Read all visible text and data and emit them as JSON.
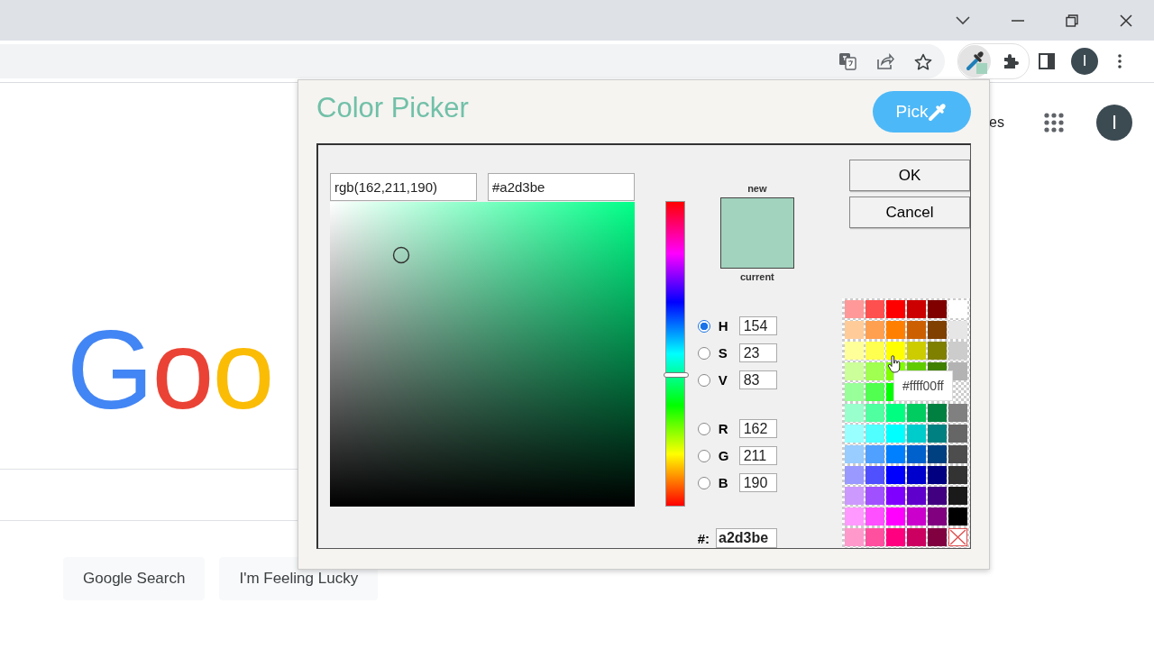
{
  "toolbar": {
    "avatar": "I"
  },
  "page": {
    "header_link": "es",
    "avatar": "I",
    "logo": [
      {
        "letter": "G",
        "color": "#4285f4"
      },
      {
        "letter": "o",
        "color": "#ea4335"
      },
      {
        "letter": "o",
        "color": "#fbbc05"
      }
    ],
    "buttons": [
      "Google Search",
      "I'm Feeling Lucky"
    ]
  },
  "picker": {
    "title": "Color Picker",
    "pick_button": "Pick",
    "rgb_value": "rgb(162,211,190)",
    "hex_value": "#a2d3be",
    "hue_slider": {
      "level": 0.43
    },
    "preview": {
      "top_label": "new",
      "bottom_label": "current"
    },
    "buttons": [
      "OK",
      "Cancel"
    ],
    "channels": [
      {
        "label": "H",
        "value": "154",
        "selected": true
      },
      {
        "label": "S",
        "value": "23",
        "selected": false
      },
      {
        "label": "V",
        "value": "83",
        "selected": false
      },
      {
        "label": "R",
        "value": "162",
        "selected": false
      },
      {
        "label": "G",
        "value": "211",
        "selected": false
      },
      {
        "label": "B",
        "value": "190",
        "selected": false
      }
    ],
    "hash_label": "#:",
    "hash_value": "a2d3be",
    "palette": [
      {
        "cells": [
          {
            "kind": "swatch",
            "color": "#ff9999"
          },
          {
            "kind": "swatch",
            "color": "#ff5050"
          },
          {
            "kind": "swatch",
            "color": "#ff0000"
          },
          {
            "kind": "swatch",
            "color": "#cc0000"
          },
          {
            "kind": "swatch",
            "color": "#800000"
          },
          {
            "kind": "swatch",
            "color": "#ffffff"
          }
        ]
      },
      {
        "cells": [
          {
            "kind": "swatch",
            "color": "#ffcc99"
          },
          {
            "kind": "swatch",
            "color": "#ffa050"
          },
          {
            "kind": "swatch",
            "color": "#ff8000"
          },
          {
            "kind": "swatch",
            "color": "#cc6000"
          },
          {
            "kind": "swatch",
            "color": "#804000"
          },
          {
            "kind": "swatch",
            "color": "#e6e6e6"
          }
        ]
      },
      {
        "cells": [
          {
            "kind": "swatch",
            "color": "#ffff99"
          },
          {
            "kind": "swatch",
            "color": "#ffff50"
          },
          {
            "kind": "swatch",
            "color": "#ffff00"
          },
          {
            "kind": "swatch",
            "color": "#cccc00"
          },
          {
            "kind": "swatch",
            "color": "#808000"
          },
          {
            "kind": "swatch",
            "color": "#cccccc"
          }
        ]
      },
      {
        "cells": [
          {
            "kind": "swatch",
            "color": "#ccff99"
          },
          {
            "kind": "swatch",
            "color": "#a0ff50"
          },
          {
            "kind": "swatch",
            "color": "#80ff00"
          },
          {
            "kind": "swatch",
            "color": "#60cc00"
          },
          {
            "kind": "swatch",
            "color": "#408000"
          },
          {
            "kind": "swatch",
            "color": "#b3b3b3"
          }
        ]
      },
      {
        "cells": [
          {
            "kind": "swatch",
            "color": "#99ff99"
          },
          {
            "kind": "swatch",
            "color": "#50ff50"
          },
          {
            "kind": "swatch",
            "color": "#00ff00"
          }
        ]
      },
      {
        "cells": [
          {
            "kind": "swatch",
            "color": "#99ffcc"
          },
          {
            "kind": "swatch",
            "color": "#50ffa0"
          },
          {
            "kind": "swatch",
            "color": "#00ff80"
          },
          {
            "kind": "swatch",
            "color": "#00cc60"
          },
          {
            "kind": "swatch",
            "color": "#008040"
          },
          {
            "kind": "swatch",
            "color": "#808080"
          }
        ]
      },
      {
        "cells": [
          {
            "kind": "swatch",
            "color": "#99ffff"
          },
          {
            "kind": "swatch",
            "color": "#50ffff"
          },
          {
            "kind": "swatch",
            "color": "#00ffff"
          },
          {
            "kind": "swatch",
            "color": "#00cccc"
          },
          {
            "kind": "swatch",
            "color": "#008080"
          },
          {
            "kind": "swatch",
            "color": "#666666"
          }
        ]
      },
      {
        "cells": [
          {
            "kind": "swatch",
            "color": "#99ccff"
          },
          {
            "kind": "swatch",
            "color": "#50a0ff"
          },
          {
            "kind": "swatch",
            "color": "#0080ff"
          },
          {
            "kind": "swatch",
            "color": "#0060cc"
          },
          {
            "kind": "swatch",
            "color": "#004080"
          },
          {
            "kind": "swatch",
            "color": "#4d4d4d"
          }
        ]
      },
      {
        "cells": [
          {
            "kind": "swatch",
            "color": "#9999ff"
          },
          {
            "kind": "swatch",
            "color": "#5050ff"
          },
          {
            "kind": "swatch",
            "color": "#0000ff"
          },
          {
            "kind": "swatch",
            "color": "#0000cc"
          },
          {
            "kind": "swatch",
            "color": "#000080"
          },
          {
            "kind": "swatch",
            "color": "#333333"
          }
        ]
      },
      {
        "cells": [
          {
            "kind": "swatch",
            "color": "#cc99ff"
          },
          {
            "kind": "swatch",
            "color": "#a050ff"
          },
          {
            "kind": "swatch",
            "color": "#8000ff"
          },
          {
            "kind": "swatch",
            "color": "#6000cc"
          },
          {
            "kind": "swatch",
            "color": "#400080"
          },
          {
            "kind": "swatch",
            "color": "#1a1a1a"
          }
        ]
      },
      {
        "cells": [
          {
            "kind": "swatch",
            "color": "#ff99ff"
          },
          {
            "kind": "swatch",
            "color": "#ff50ff"
          },
          {
            "kind": "swatch",
            "color": "#ff00ff"
          },
          {
            "kind": "swatch",
            "color": "#cc00cc"
          },
          {
            "kind": "swatch",
            "color": "#800080"
          },
          {
            "kind": "swatch",
            "color": "#000000"
          }
        ]
      },
      {
        "cells": [
          {
            "kind": "swatch",
            "color": "#ff99cc"
          },
          {
            "kind": "swatch",
            "color": "#ff50a0"
          },
          {
            "kind": "swatch",
            "color": "#ff0080"
          },
          {
            "kind": "swatch",
            "color": "#cc0060"
          },
          {
            "kind": "swatch",
            "color": "#800040"
          },
          {
            "kind": "none"
          }
        ]
      }
    ],
    "tooltip": "#ffff00ff"
  }
}
